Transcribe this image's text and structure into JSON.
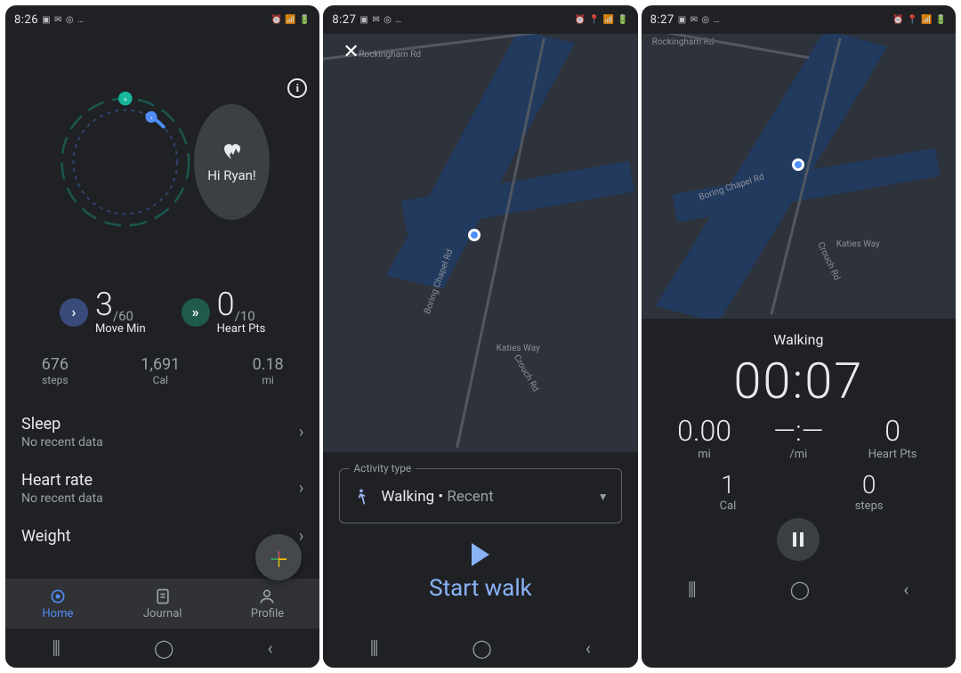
{
  "status": {
    "time1": "8:26",
    "time2": "8:27",
    "time3": "8:27"
  },
  "home": {
    "greeting": "Hi Ryan!",
    "move_min_val": "3",
    "move_min_goal": "/60",
    "move_min_label": "Move Min",
    "heart_pts_val": "0",
    "heart_pts_goal": "/10",
    "heart_pts_label": "Heart Pts",
    "steps_val": "676",
    "steps_lbl": "steps",
    "cal_val": "1,691",
    "cal_lbl": "Cal",
    "mi_val": "0.18",
    "mi_lbl": "mi",
    "rows": {
      "sleep_title": "Sleep",
      "sleep_sub": "No recent data",
      "hr_title": "Heart rate",
      "hr_sub": "No recent data",
      "weight_title": "Weight"
    },
    "nav_home": "Home",
    "nav_journal": "Journal",
    "nav_profile": "Profile"
  },
  "map_labels": {
    "rockingham": "Rockingham Rd",
    "boring": "Boring Chapel Rd",
    "crouch": "Crouch Rd",
    "katies": "Katies Way"
  },
  "picker": {
    "legend": "Activity type",
    "name": "Walking",
    "recent": "Recent",
    "start": "Start walk"
  },
  "active": {
    "title": "Walking",
    "timer": "00:07",
    "dist_val": "0.00",
    "dist_lbl": "mi",
    "pace_val": "—:—",
    "pace_lbl": "/mi",
    "hp_val": "0",
    "hp_lbl": "Heart Pts",
    "cal_val": "1",
    "cal_lbl": "Cal",
    "steps_val": "0",
    "steps_lbl": "steps"
  },
  "colors": {
    "accent_blue": "#4f8df7",
    "accent_green": "#14b89a",
    "link_blue": "#8ab4f8"
  }
}
